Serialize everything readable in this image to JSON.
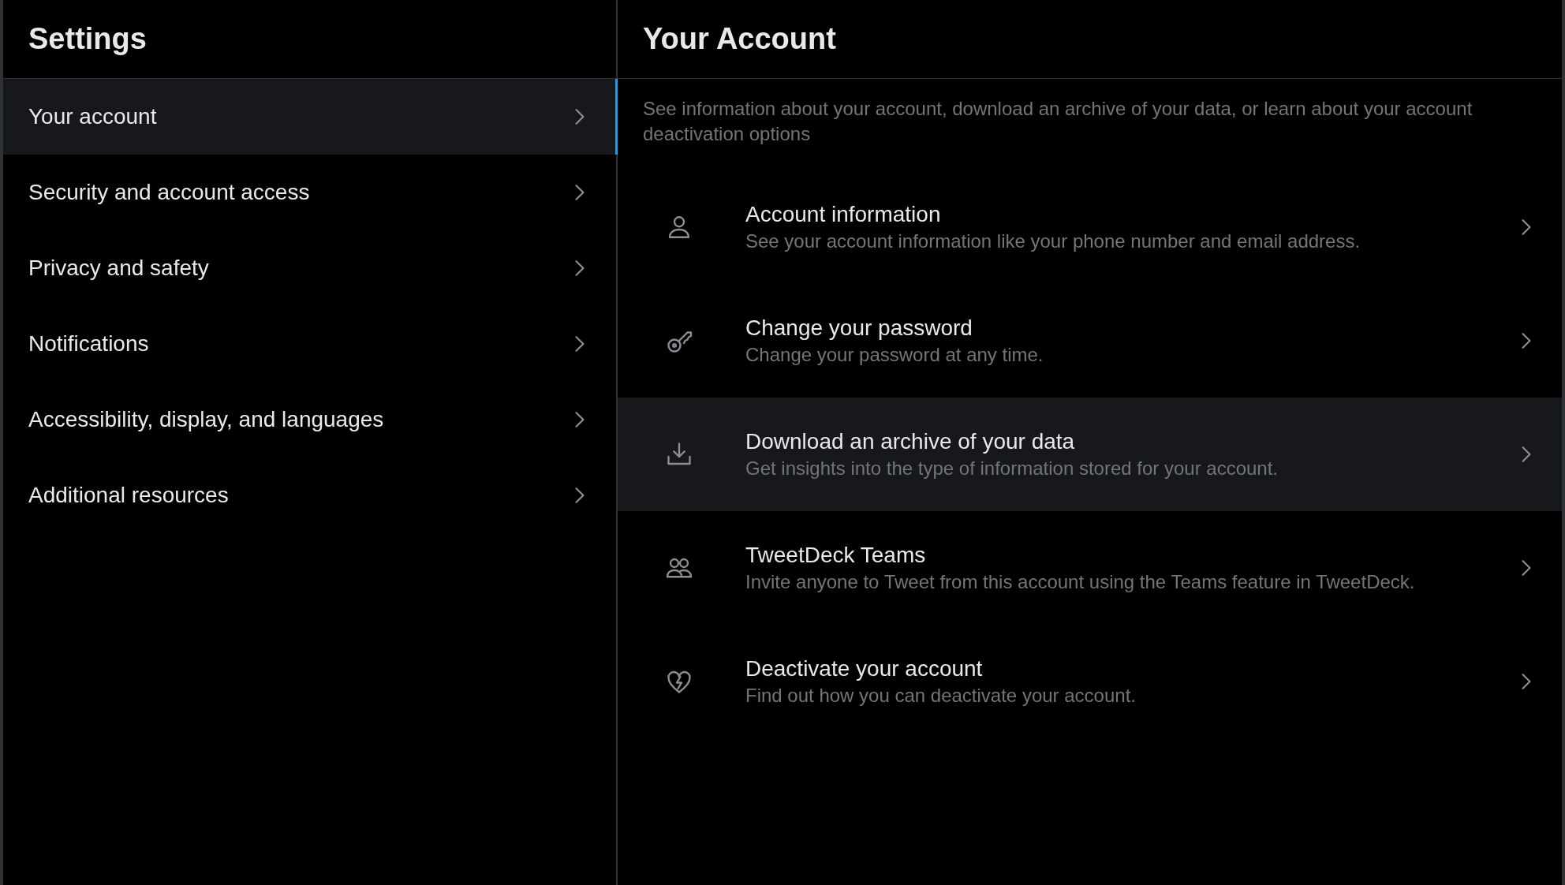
{
  "sidebar": {
    "title": "Settings",
    "items": [
      {
        "label": "Your account",
        "selected": true
      },
      {
        "label": "Security and account access",
        "selected": false
      },
      {
        "label": "Privacy and safety",
        "selected": false
      },
      {
        "label": "Notifications",
        "selected": false
      },
      {
        "label": "Accessibility, display, and languages",
        "selected": false
      },
      {
        "label": "Additional resources",
        "selected": false
      }
    ]
  },
  "main": {
    "title": "Your Account",
    "description": "See information about your account, download an archive of your data, or learn about your account deactivation options",
    "items": [
      {
        "kind": "person",
        "title": "Account information",
        "subtitle": "See your account information like your phone number and email address.",
        "highlighted": false
      },
      {
        "kind": "key",
        "title": "Change your password",
        "subtitle": "Change your password at any time.",
        "highlighted": false
      },
      {
        "kind": "download",
        "title": "Download an archive of your data",
        "subtitle": "Get insights into the type of information stored for your account.",
        "highlighted": true
      },
      {
        "kind": "people",
        "title": "TweetDeck Teams",
        "subtitle": "Invite anyone to Tweet from this account using the Teams feature in TweetDeck.",
        "highlighted": false
      },
      {
        "kind": "heart",
        "title": "Deactivate your account",
        "subtitle": "Find out how you can deactivate your account.",
        "highlighted": false
      }
    ]
  }
}
